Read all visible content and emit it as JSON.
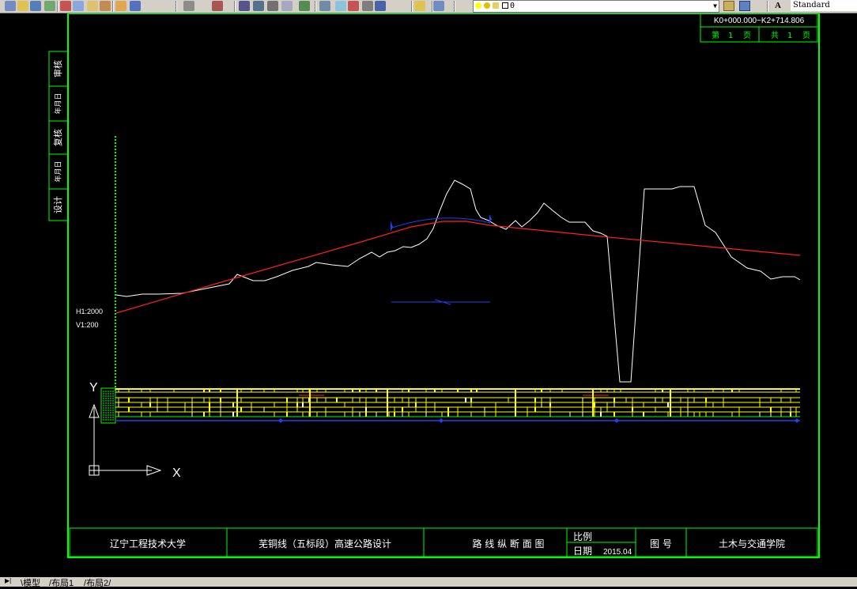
{
  "app": {
    "style_name": "Standard",
    "layer_name": "0"
  },
  "toolbar": {
    "buttons": [
      "new-file-icon",
      "open-file-icon",
      "save-icon",
      "plot-icon",
      "cut-icon",
      "copy-icon",
      "paste-icon",
      "match-properties-icon",
      "brush-icon",
      "undo-icon",
      "redo-icon",
      "pan-icon",
      "zoom-realtime-icon",
      "zoom-window-icon",
      "zoom-previous-icon",
      "properties-icon",
      "design-center-icon",
      "tool-palettes-icon",
      "sheet-set-icon",
      "markup-icon",
      "calculator-icon",
      "help-icon",
      "layer-manager-icon",
      "layer-state-icon"
    ]
  },
  "drawing": {
    "station_range": "K0+000.000~K2+714.806",
    "page_label": "第",
    "page_num": "1",
    "page_unit": "页",
    "total_label": "共",
    "total_num": "1",
    "total_unit": "页",
    "side_labels": [
      "审核",
      "年月日",
      "复核",
      "年月日",
      "设计"
    ],
    "scale_h": "H1:2000",
    "scale_v": "V1:200",
    "ucs_x": "X",
    "ucs_y": "Y"
  },
  "title_block": {
    "university": "辽宁工程技术大学",
    "project": "芜铜线（五标段）高速公路设计",
    "drawing_name": "路 线 纵 断 面 图",
    "scale_label": "比例",
    "date_label": "日期",
    "date_value": "2015.04",
    "drawing_no_label": "图 号",
    "college": "土木与交通学院"
  },
  "tabs": [
    "模型",
    "布局1",
    "布局2"
  ],
  "colors": {
    "frame": "#00ff00",
    "ground_line": "#ffffff",
    "design_line": "#ff2020",
    "vertical_curve": "#2040ff",
    "data_table": "#ffff00",
    "background": "#000000"
  }
}
